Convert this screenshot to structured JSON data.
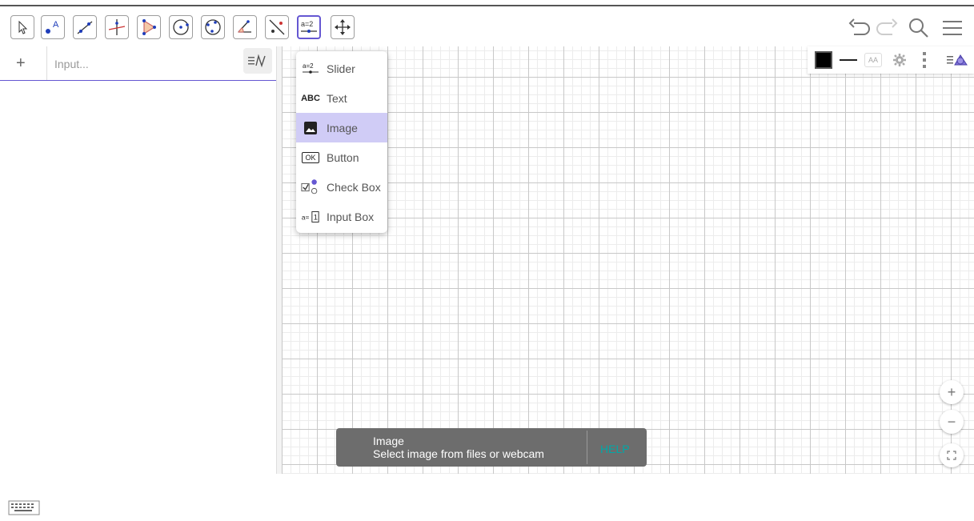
{
  "toolbar": {
    "tools": [
      {
        "name": "move-tool",
        "icon": "arrow-pointer-icon"
      },
      {
        "name": "point-tool",
        "icon": "point-icon",
        "label": "A"
      },
      {
        "name": "line-tool",
        "icon": "line-icon"
      },
      {
        "name": "perpendicular-tool",
        "icon": "perpendicular-icon"
      },
      {
        "name": "polygon-tool",
        "icon": "polygon-icon"
      },
      {
        "name": "circle-center-tool",
        "icon": "circle-center-icon"
      },
      {
        "name": "circle-three-points-tool",
        "icon": "circle-three-points-icon"
      },
      {
        "name": "angle-tool",
        "icon": "angle-icon"
      },
      {
        "name": "reflect-tool",
        "icon": "reflect-icon"
      },
      {
        "name": "slider-tool",
        "icon": "slider-icon",
        "label": "a=2",
        "active": true
      },
      {
        "name": "move-graphics-tool",
        "icon": "move-graphics-icon"
      }
    ],
    "right": [
      "undo-icon",
      "redo-icon",
      "search-icon",
      "menu-icon"
    ]
  },
  "algebra": {
    "add_symbol": "+",
    "input_placeholder": "Input..."
  },
  "style_bar": {
    "color": "#000000",
    "text_size_label": "AA"
  },
  "dropdown": {
    "items": [
      {
        "icon_text": "a=2",
        "label": "Slider"
      },
      {
        "icon_text": "ABC",
        "label": "Text"
      },
      {
        "icon_text": "",
        "label": "Image",
        "selected": true
      },
      {
        "icon_text": "OK",
        "label": "Button"
      },
      {
        "icon_text": "",
        "label": "Check Box"
      },
      {
        "icon_text": "a=1",
        "label": "Input Box"
      }
    ]
  },
  "zoom": {
    "in": "+",
    "out": "−"
  },
  "toast": {
    "title": "Image",
    "message": "Select image from files or webcam",
    "help": "HELP"
  },
  "colors": {
    "accent": "#6557d2",
    "selected": "#d0ccf6",
    "help": "#00a8a8"
  }
}
